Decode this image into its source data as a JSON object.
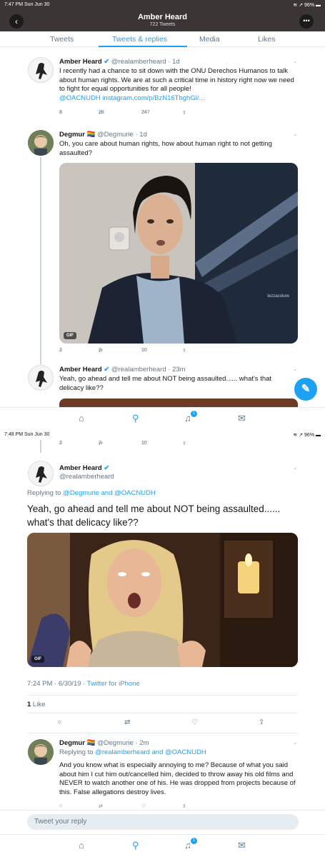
{
  "screen1": {
    "status": {
      "left": "7:47 PM  Sun Jun 30",
      "right": "≋ ↗ 96% ▬"
    },
    "header": {
      "name": "Amber Heard",
      "tweet_count": "722 Tweets"
    },
    "tabs": [
      "Tweets",
      "Tweets & replies",
      "Media",
      "Likes"
    ],
    "tweet1": {
      "name": "Amber Heard",
      "handle_time": "@realamberheard · 1d",
      "text": "I recently had a chance to sit down with the ONU Derechos Humanos to talk about human rights. We are at such a critical time in history right now we need to fight for equal opportunities for all people!",
      "links": "@OACNUDH  instagram.com/p/BzN16TbghGl/...",
      "replies": "8",
      "retweets": "29",
      "likes": "247"
    },
    "tweet2": {
      "name": "Degmur 🏳️‍🌈",
      "handle_time": "@Degmurie · 1d",
      "text": "Oh, you care about human rights, how about human right to not getting assaulted?",
      "gif_label": "GIF",
      "watermark": "tezzacolure",
      "replies": "2",
      "retweets": "2",
      "likes": "10"
    },
    "tweet3": {
      "name": "Amber Heard",
      "handle_time": "@realamberheard · 23m",
      "text": "Yeah, go ahead and tell me about NOT being assaulted...... what's that delicacy like??"
    },
    "nav_badge": "1"
  },
  "screen2": {
    "status": {
      "left": "7:48 PM  Sun Jun 30",
      "right": "≋ ↗ 96% ▬"
    },
    "top_actions": {
      "replies": "2",
      "retweets": "2",
      "likes": "10"
    },
    "main": {
      "name": "Amber Heard",
      "handle": "@realamberheard",
      "replying_prefix": "Replying to ",
      "replying_targets": "@Degmurie and @OACNUDH",
      "text": "Yeah, go ahead and tell me about NOT being assaulted...... what's that delicacy like??",
      "gif_label": "GIF",
      "time": "7:24 PM · 6/30/19 · ",
      "source": "Twitter for iPhone",
      "likes_count": "1",
      "likes_label": " Like"
    },
    "reply": {
      "name": "Degmur 🏳️‍🌈",
      "handle_time": "@Degmurie · 2m",
      "replying_prefix": "Replying to ",
      "replying_targets": "@realamberheard and @OACNUDH",
      "text": "And you know what is especially annoying to me? Because of what you said about him I cut him out/cancelled him, decided to throw away his old films and NEVER to watch another one of his. He was dropped from projects because of this. False allegations destroy lives."
    },
    "reply_placeholder": "Tweet your reply",
    "nav_badge": "1"
  }
}
